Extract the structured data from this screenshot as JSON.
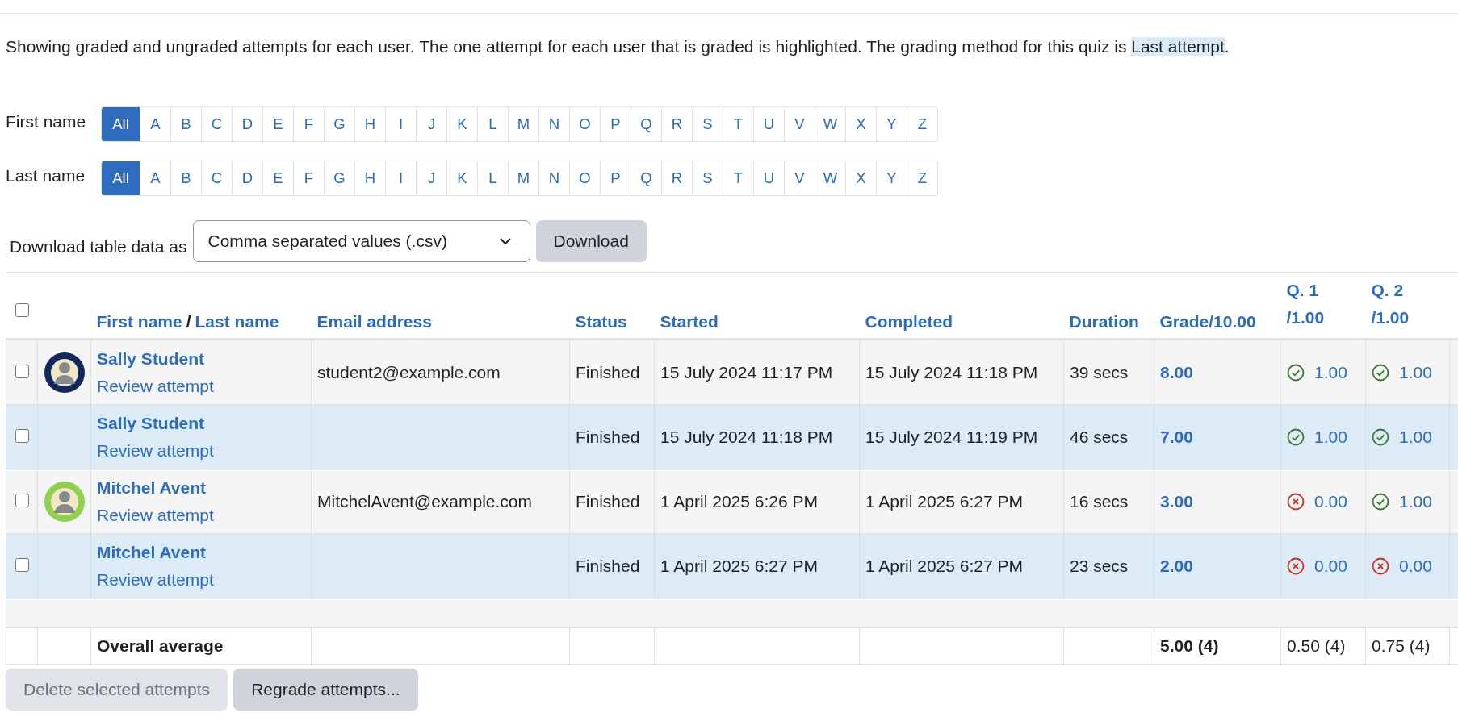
{
  "intro": {
    "text": "Showing graded and ungraded attempts for each user. The one attempt for each user that is graded is highlighted. The grading method for this quiz is ",
    "highlight": "Last attempt",
    "after": "."
  },
  "initials_filters": [
    {
      "label": "First name",
      "letters": [
        {
          "text": "All",
          "selected": true
        },
        {
          "text": "A",
          "selected": false
        },
        {
          "text": "B",
          "selected": false
        },
        {
          "text": "C",
          "selected": false
        },
        {
          "text": "D",
          "selected": false
        },
        {
          "text": "E",
          "selected": false
        },
        {
          "text": "F",
          "selected": false
        },
        {
          "text": "G",
          "selected": false
        },
        {
          "text": "H",
          "selected": false
        },
        {
          "text": "I",
          "selected": false
        },
        {
          "text": "J",
          "selected": false
        },
        {
          "text": "K",
          "selected": false
        },
        {
          "text": "L",
          "selected": false
        },
        {
          "text": "M",
          "selected": false
        },
        {
          "text": "N",
          "selected": false
        },
        {
          "text": "O",
          "selected": false
        },
        {
          "text": "P",
          "selected": false
        },
        {
          "text": "Q",
          "selected": false
        },
        {
          "text": "R",
          "selected": false
        },
        {
          "text": "S",
          "selected": false
        },
        {
          "text": "T",
          "selected": false
        },
        {
          "text": "U",
          "selected": false
        },
        {
          "text": "V",
          "selected": false
        },
        {
          "text": "W",
          "selected": false
        },
        {
          "text": "X",
          "selected": false
        },
        {
          "text": "Y",
          "selected": false
        },
        {
          "text": "Z",
          "selected": false
        }
      ]
    },
    {
      "label": "Last name",
      "letters": [
        {
          "text": "All",
          "selected": true
        },
        {
          "text": "A",
          "selected": false
        },
        {
          "text": "B",
          "selected": false
        },
        {
          "text": "C",
          "selected": false
        },
        {
          "text": "D",
          "selected": false
        },
        {
          "text": "E",
          "selected": false
        },
        {
          "text": "F",
          "selected": false
        },
        {
          "text": "G",
          "selected": false
        },
        {
          "text": "H",
          "selected": false
        },
        {
          "text": "I",
          "selected": false
        },
        {
          "text": "J",
          "selected": false
        },
        {
          "text": "K",
          "selected": false
        },
        {
          "text": "L",
          "selected": false
        },
        {
          "text": "M",
          "selected": false
        },
        {
          "text": "N",
          "selected": false
        },
        {
          "text": "O",
          "selected": false
        },
        {
          "text": "P",
          "selected": false
        },
        {
          "text": "Q",
          "selected": false
        },
        {
          "text": "R",
          "selected": false
        },
        {
          "text": "S",
          "selected": false
        },
        {
          "text": "T",
          "selected": false
        },
        {
          "text": "U",
          "selected": false
        },
        {
          "text": "V",
          "selected": false
        },
        {
          "text": "W",
          "selected": false
        },
        {
          "text": "X",
          "selected": false
        },
        {
          "text": "Y",
          "selected": false
        },
        {
          "text": "Z",
          "selected": false
        }
      ]
    }
  ],
  "download": {
    "label": "Download table data as",
    "format": "Comma separated values (.csv)",
    "button": "Download"
  },
  "table": {
    "header_checkbox": {
      "checked": false
    },
    "columns": {
      "first_name": "First name",
      "separator": "/",
      "last_name": "Last name",
      "email": "Email address",
      "status": "Status",
      "started": "Started",
      "completed": "Completed",
      "duration": "Duration",
      "grade": "Grade/10.00",
      "questions": [
        {
          "line1": "Q. 1",
          "line2": "/1.00"
        },
        {
          "line1": "Q. 2",
          "line2": "/1.00"
        }
      ]
    },
    "rows": [
      {
        "checked": false,
        "graded": false,
        "avatar": {
          "color": "#13295e"
        },
        "name": "Sally Student",
        "review": "Review attempt",
        "email": "student2@example.com",
        "status": "Finished",
        "started": "15 July 2024 11:17 PM",
        "completed": "15 July 2024 11:18 PM",
        "duration": "39 secs",
        "grade": "8.00",
        "questions": [
          {
            "correct": true,
            "mark": "1.00"
          },
          {
            "correct": true,
            "mark": "1.00"
          }
        ]
      },
      {
        "checked": false,
        "graded": true,
        "name": "Sally Student",
        "review": "Review attempt",
        "status": "Finished",
        "started": "15 July 2024 11:18 PM",
        "completed": "15 July 2024 11:19 PM",
        "duration": "46 secs",
        "grade": "7.00",
        "questions": [
          {
            "correct": true,
            "mark": "1.00"
          },
          {
            "correct": true,
            "mark": "1.00"
          }
        ]
      },
      {
        "checked": false,
        "graded": false,
        "avatar": {
          "color": "#8fd14f"
        },
        "name": "Mitchel Avent",
        "review": "Review attempt",
        "email": "MitchelAvent@example.com",
        "status": "Finished",
        "started": "1 April 2025 6:26 PM",
        "completed": "1 April 2025 6:27 PM",
        "duration": "16 secs",
        "grade": "3.00",
        "questions": [
          {
            "correct": false,
            "mark": "0.00"
          },
          {
            "correct": true,
            "mark": "1.00"
          }
        ]
      },
      {
        "checked": false,
        "graded": true,
        "name": "Mitchel Avent",
        "review": "Review attempt",
        "status": "Finished",
        "started": "1 April 2025 6:27 PM",
        "completed": "1 April 2025 6:27 PM",
        "duration": "23 secs",
        "grade": "2.00",
        "questions": [
          {
            "correct": false,
            "mark": "0.00"
          },
          {
            "correct": false,
            "mark": "0.00"
          }
        ]
      }
    ],
    "footer": {
      "label": "Overall average",
      "grade": "5.00 (4)",
      "questions": [
        "0.50 (4)",
        "0.75 (4)"
      ]
    }
  },
  "buttons": [
    {
      "label": "Delete selected attempts",
      "disabled": true
    },
    {
      "label": "Regrade attempts...",
      "disabled": false
    }
  ]
}
